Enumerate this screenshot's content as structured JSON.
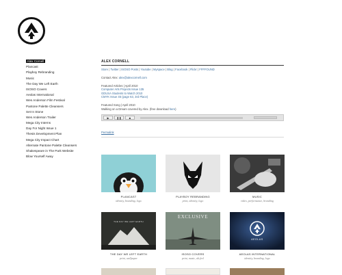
{
  "colors": {
    "link": "#3b6fa0",
    "text": "#222222",
    "active_bg": "#111111"
  },
  "logo": {
    "icon": "aeolus-arrow-logo-icon"
  },
  "sidebar": {
    "items": [
      {
        "label": "Alex Cornell",
        "active": true
      },
      {
        "label": "Plancast"
      },
      {
        "label": "Playboy Rebranding"
      },
      {
        "label": "Music"
      },
      {
        "label": "The Day We Left Earth"
      },
      {
        "label": "ISOSO Covers"
      },
      {
        "label": "Aeolas International"
      },
      {
        "label": "Wes Anderson Film Festival"
      },
      {
        "label": "Pantone Palette Cleansers"
      },
      {
        "label": "Set In Stone"
      },
      {
        "label": "Wes Anderson Trailer"
      },
      {
        "label": "Mega City Interns"
      },
      {
        "label": "Day For Night Issue 1"
      },
      {
        "label": "Thesis Development Plan"
      },
      {
        "label": "Mega City Impact Chart"
      },
      {
        "label": "Alternate Pantone Palette Cleansers"
      },
      {
        "label": "Shakespeare in The Park Website"
      },
      {
        "label": "Blow Yourself Away"
      }
    ]
  },
  "main": {
    "title": "ALEX CORNELL",
    "links": [
      "Store",
      "Twitter",
      "ISOSO Posts",
      "Youtube",
      "Myspace",
      "Blog",
      "Facebook",
      "Flickr",
      "FFFFOUND"
    ],
    "separator": " | ",
    "contact_label": "Contact Alex: ",
    "contact_email": "alex@alexcornell.com",
    "featured_articles_heading": "Featured Articles | April 2010",
    "featured_articles": [
      "Computer Arts Projects Issue 135",
      "GDUSA Students to Watch 2010",
      "CMYK Issue 45 (page 63, 3rd Place)"
    ],
    "featured_song_heading": "Featured Song | April 2010",
    "featured_song_text": "Walking on a Dream covered by Alex. (free download ",
    "featured_song_link": "here",
    "featured_song_end": ")",
    "player": {
      "play_icon": "play-icon",
      "pause_icon": "pause-icon",
      "stop_icon": "stop-icon"
    },
    "permalink": "Permalink"
  },
  "portfolio": [
    {
      "title": "PLANCAST",
      "subtitle": "identity, branding, logo",
      "image": "penguin-illustration"
    },
    {
      "title": "PLAYBOY REBRANDING",
      "subtitle": "print, identity, logo",
      "image": "fox-logo"
    },
    {
      "title": "MUSIC",
      "subtitle": "video, performance, branding",
      "image": "guitar-photo"
    },
    {
      "title": "THE DAY WE LEFT EARTH",
      "subtitle": "print, wallpaper",
      "image": "mountain-poster",
      "overlay": "THE DAY WE LEFT EARTH"
    },
    {
      "title": "ISOSO COVERS",
      "subtitle": "print, music, alt.feel",
      "image": "airplane-poster",
      "overlay": "EXCLUSIVE"
    },
    {
      "title": "AEOLAS INTERNATIONAL",
      "subtitle": "identity, branding, logo",
      "image": "aeolas-logo",
      "overlay": "AEOLAS"
    }
  ]
}
